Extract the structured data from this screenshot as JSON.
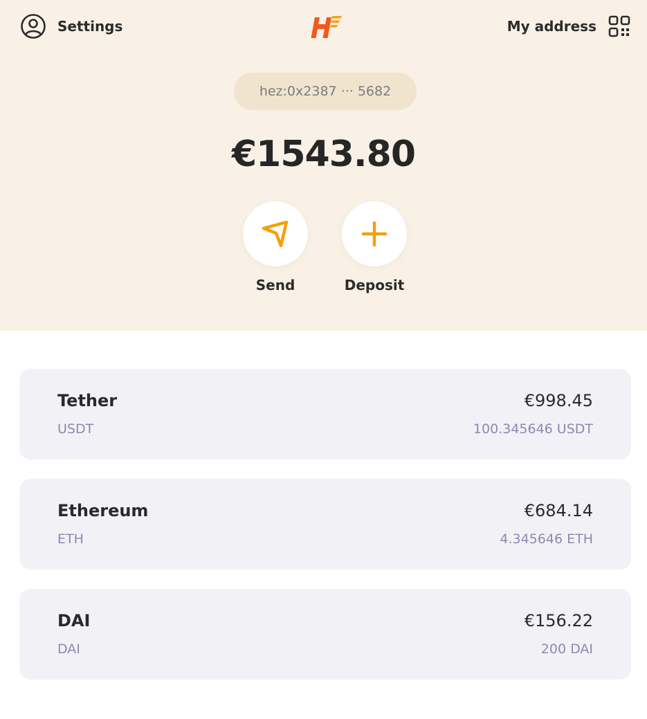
{
  "header": {
    "settings_label": "Settings",
    "settings_icon": "user-circle-icon",
    "logo_icon": "hermez-logo",
    "my_address_label": "My address",
    "qr_icon": "qr-code-icon",
    "address": "hez:0x2387 ··· 5682",
    "balance": "€1543.80",
    "actions": [
      {
        "label": "Send",
        "icon": "send-arrow-icon"
      },
      {
        "label": "Deposit",
        "icon": "plus-icon"
      }
    ]
  },
  "tokens": [
    {
      "name": "Tether",
      "symbol": "USDT",
      "fiat_value": "€998.45",
      "amount": "100.345646 USDT"
    },
    {
      "name": "Ethereum",
      "symbol": "ETH",
      "fiat_value": "€684.14",
      "amount": "4.345646 ETH"
    },
    {
      "name": "DAI",
      "symbol": "DAI",
      "fiat_value": "€156.22",
      "amount": "200 DAI"
    }
  ],
  "colors": {
    "header_bg": "#f9f1e6",
    "address_pill_bg": "#f1e4cf",
    "accent": "#f5a00c",
    "logo_orange": "#ef5a1c",
    "card_bg": "#f2f2f6",
    "muted_text": "#8a89b2"
  }
}
